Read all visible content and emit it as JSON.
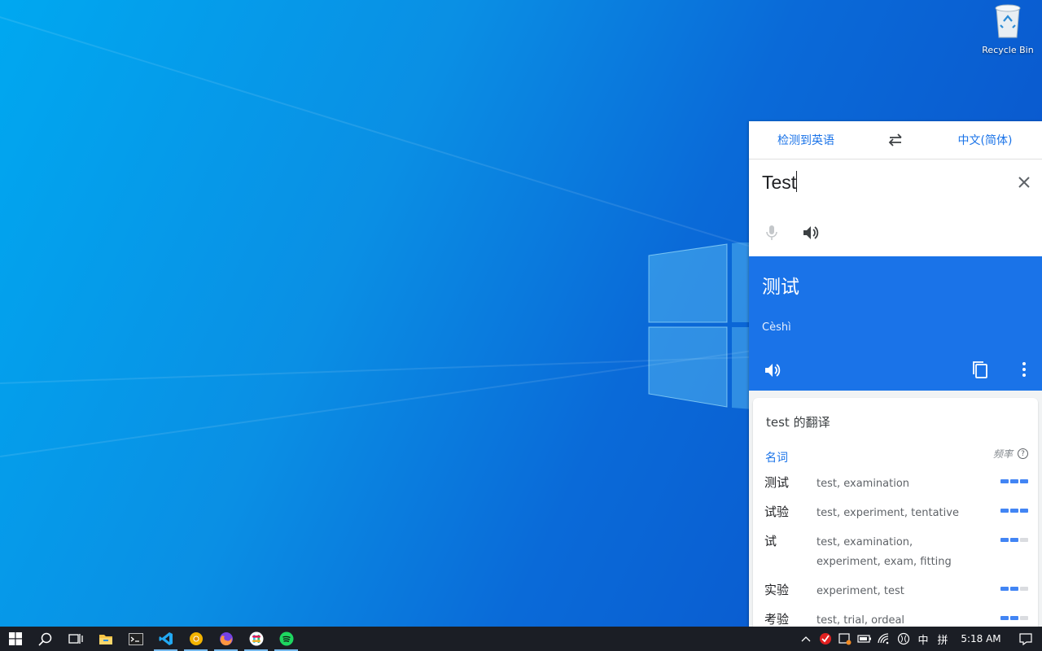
{
  "desktop": {
    "recycle_bin_label": "Recycle Bin"
  },
  "translator": {
    "source_language": "检测到英语",
    "target_language": "中文(简体)",
    "input_text": "Test",
    "output_text": "测试",
    "output_pinyin": "Cèshì",
    "dictionary": {
      "title": "test 的翻译",
      "part_of_speech": "名词",
      "frequency_label": "频率",
      "help_glyph": "?",
      "entries": [
        {
          "word": "测试",
          "meanings": "test, examination",
          "frequency": 3
        },
        {
          "word": "试验",
          "meanings": "test, experiment, tentative",
          "frequency": 3
        },
        {
          "word": "试",
          "meanings": "test, examination, experiment, exam, fitting",
          "frequency": 2
        },
        {
          "word": "实验",
          "meanings": "experiment, test",
          "frequency": 2
        },
        {
          "word": "考验",
          "meanings": "test, trial, ordeal",
          "frequency": 2
        }
      ]
    },
    "colors": {
      "accent": "#1a73e8",
      "frequency_on": "#4285f4",
      "frequency_off": "#dadce0"
    }
  },
  "taskbar": {
    "apps": [
      {
        "icon": "start-windows-icon"
      },
      {
        "icon": "search-icon"
      },
      {
        "icon": "task-view-icon"
      },
      {
        "icon": "file-explorer-icon"
      },
      {
        "icon": "terminal-icon"
      },
      {
        "icon": "vscode-icon",
        "active": true
      },
      {
        "icon": "chrome-icon",
        "active": true
      },
      {
        "icon": "firefox-icon",
        "active": true
      },
      {
        "icon": "slack-icon",
        "active": true
      },
      {
        "icon": "spotify-icon",
        "active": true
      }
    ],
    "tray": {
      "ime_language": "中",
      "ime_mode": "拼",
      "clock": "5:18 AM"
    }
  }
}
